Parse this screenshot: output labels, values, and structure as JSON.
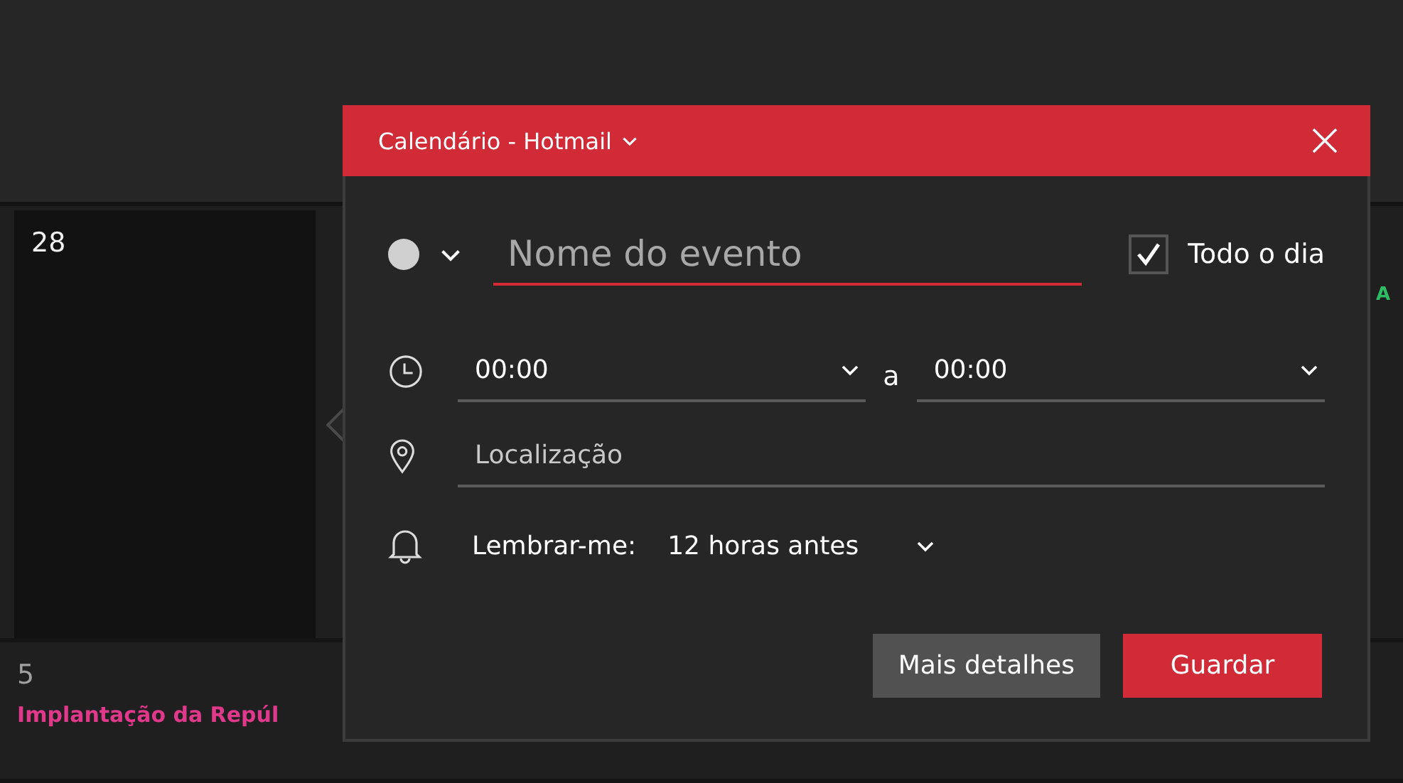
{
  "calendar": {
    "selected_day": {
      "day": "28"
    },
    "edge_event": {
      "title": "A",
      "color": "#2dbd63"
    },
    "day": {
      "day": "5",
      "events": [
        {
          "title": "Implantação da Repúl",
          "color": "#e0398b"
        }
      ]
    }
  },
  "popup": {
    "calendar_name": "Calendário - Hotmail",
    "event_color": {
      "color": "#d0d0d0"
    },
    "event_name": {
      "placeholder": "Nome do evento"
    },
    "all_day": {
      "label": "Todo o dia",
      "checked": true
    },
    "start_time": "00:00",
    "separator": "a",
    "end_time": "00:00",
    "location": {
      "placeholder": "Localização"
    },
    "reminder": {
      "label": "Lembrar-me:",
      "value": "12 horas antes"
    },
    "buttons": [
      {
        "label": "Mais detalhes",
        "kind": "secondary"
      },
      {
        "label": "Guardar",
        "kind": "primary"
      }
    ]
  }
}
